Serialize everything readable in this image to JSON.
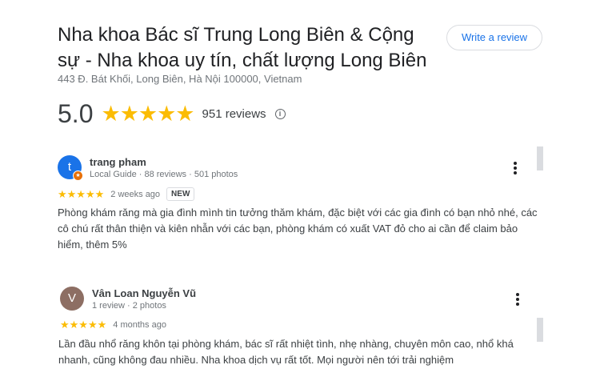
{
  "place": {
    "title": "Nha khoa Bác sĩ Trung Long Biên & Cộng sự - Nha khoa uy tín, chất lượng Long Biên",
    "address": "443 Đ. Bát Khối, Long Biên, Hà Nội 100000, Vietnam",
    "write_review_label": "Write a review",
    "rating": "5.0",
    "rating_stars": "★★★★★",
    "review_count": "951 reviews",
    "info_icon": "info-icon"
  },
  "reviews": [
    {
      "avatar_letter": "t",
      "avatar_color": "#1a73e8",
      "local_guide_badge": true,
      "name": "trang pham",
      "meta": "Local Guide · 88 reviews · 501 photos",
      "stars": "★★★★★",
      "rating": 5,
      "when": "2 weeks ago",
      "badge": "NEW",
      "text": "Phòng khám răng mà gia đình mình tin tưởng thăm khám, đặc biệt với các gia đình có bạn nhỏ nhé, các cô chú rất thân thiện và kiên nhẫn với các bạn, phòng khám có xuất VAT đỏ cho ai cần để claim bảo hiểm, thêm 5%"
    },
    {
      "avatar_letter": "V",
      "avatar_color": "#8d6e63",
      "local_guide_badge": false,
      "name": "Vân Loan Nguyễn Vũ",
      "meta": "1 review · 2 photos",
      "stars": "★★★★★",
      "rating": 5,
      "when": "4 months ago",
      "text": "Lần đầu nhổ răng khôn tại phòng khám, bác sĩ rất nhiệt tình, nhẹ nhàng, chuyên môn cao, nhổ khá nhanh, cũng không đau nhiều. Nha khoa dịch vụ rất tốt. Mọi người nên tới trải nghiệm"
    }
  ]
}
